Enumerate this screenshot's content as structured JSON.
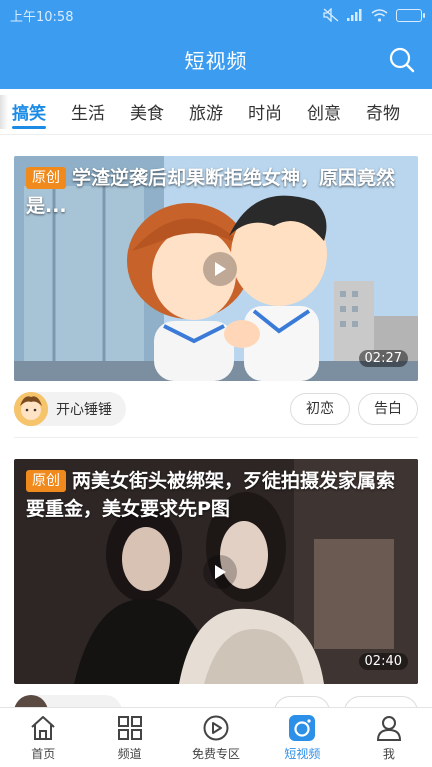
{
  "status_bar": {
    "time": "上午10:58",
    "battery": ""
  },
  "header": {
    "title": "短视频"
  },
  "tabs": [
    {
      "label": "搞笑",
      "active": true
    },
    {
      "label": "生活"
    },
    {
      "label": "美食"
    },
    {
      "label": "旅游"
    },
    {
      "label": "时尚"
    },
    {
      "label": "创意"
    },
    {
      "label": "奇物"
    }
  ],
  "videos": [
    {
      "badge": "原创",
      "title": "学渣逆袭后却果断拒绝女神，原因竟然是...",
      "duration": "02:27",
      "author": "开心锤锤",
      "tags": [
        "初恋",
        "告白"
      ]
    },
    {
      "badge": "原创",
      "title": "两美女街头被绑架，歹徒拍摄发家属索要重金，美女要求先P图",
      "duration": "02:40",
      "author": "",
      "tags": []
    }
  ],
  "bottom_nav": [
    {
      "label": "首页",
      "icon": "home-icon"
    },
    {
      "label": "频道",
      "icon": "grid-icon"
    },
    {
      "label": "免费专区",
      "icon": "play-circle-icon"
    },
    {
      "label": "短视频",
      "icon": "camera-icon",
      "active": true
    },
    {
      "label": "我",
      "icon": "person-icon"
    }
  ],
  "colors": {
    "primary": "#3b9cf0",
    "accent": "#1c8be6",
    "badge": "#f08a1c"
  }
}
